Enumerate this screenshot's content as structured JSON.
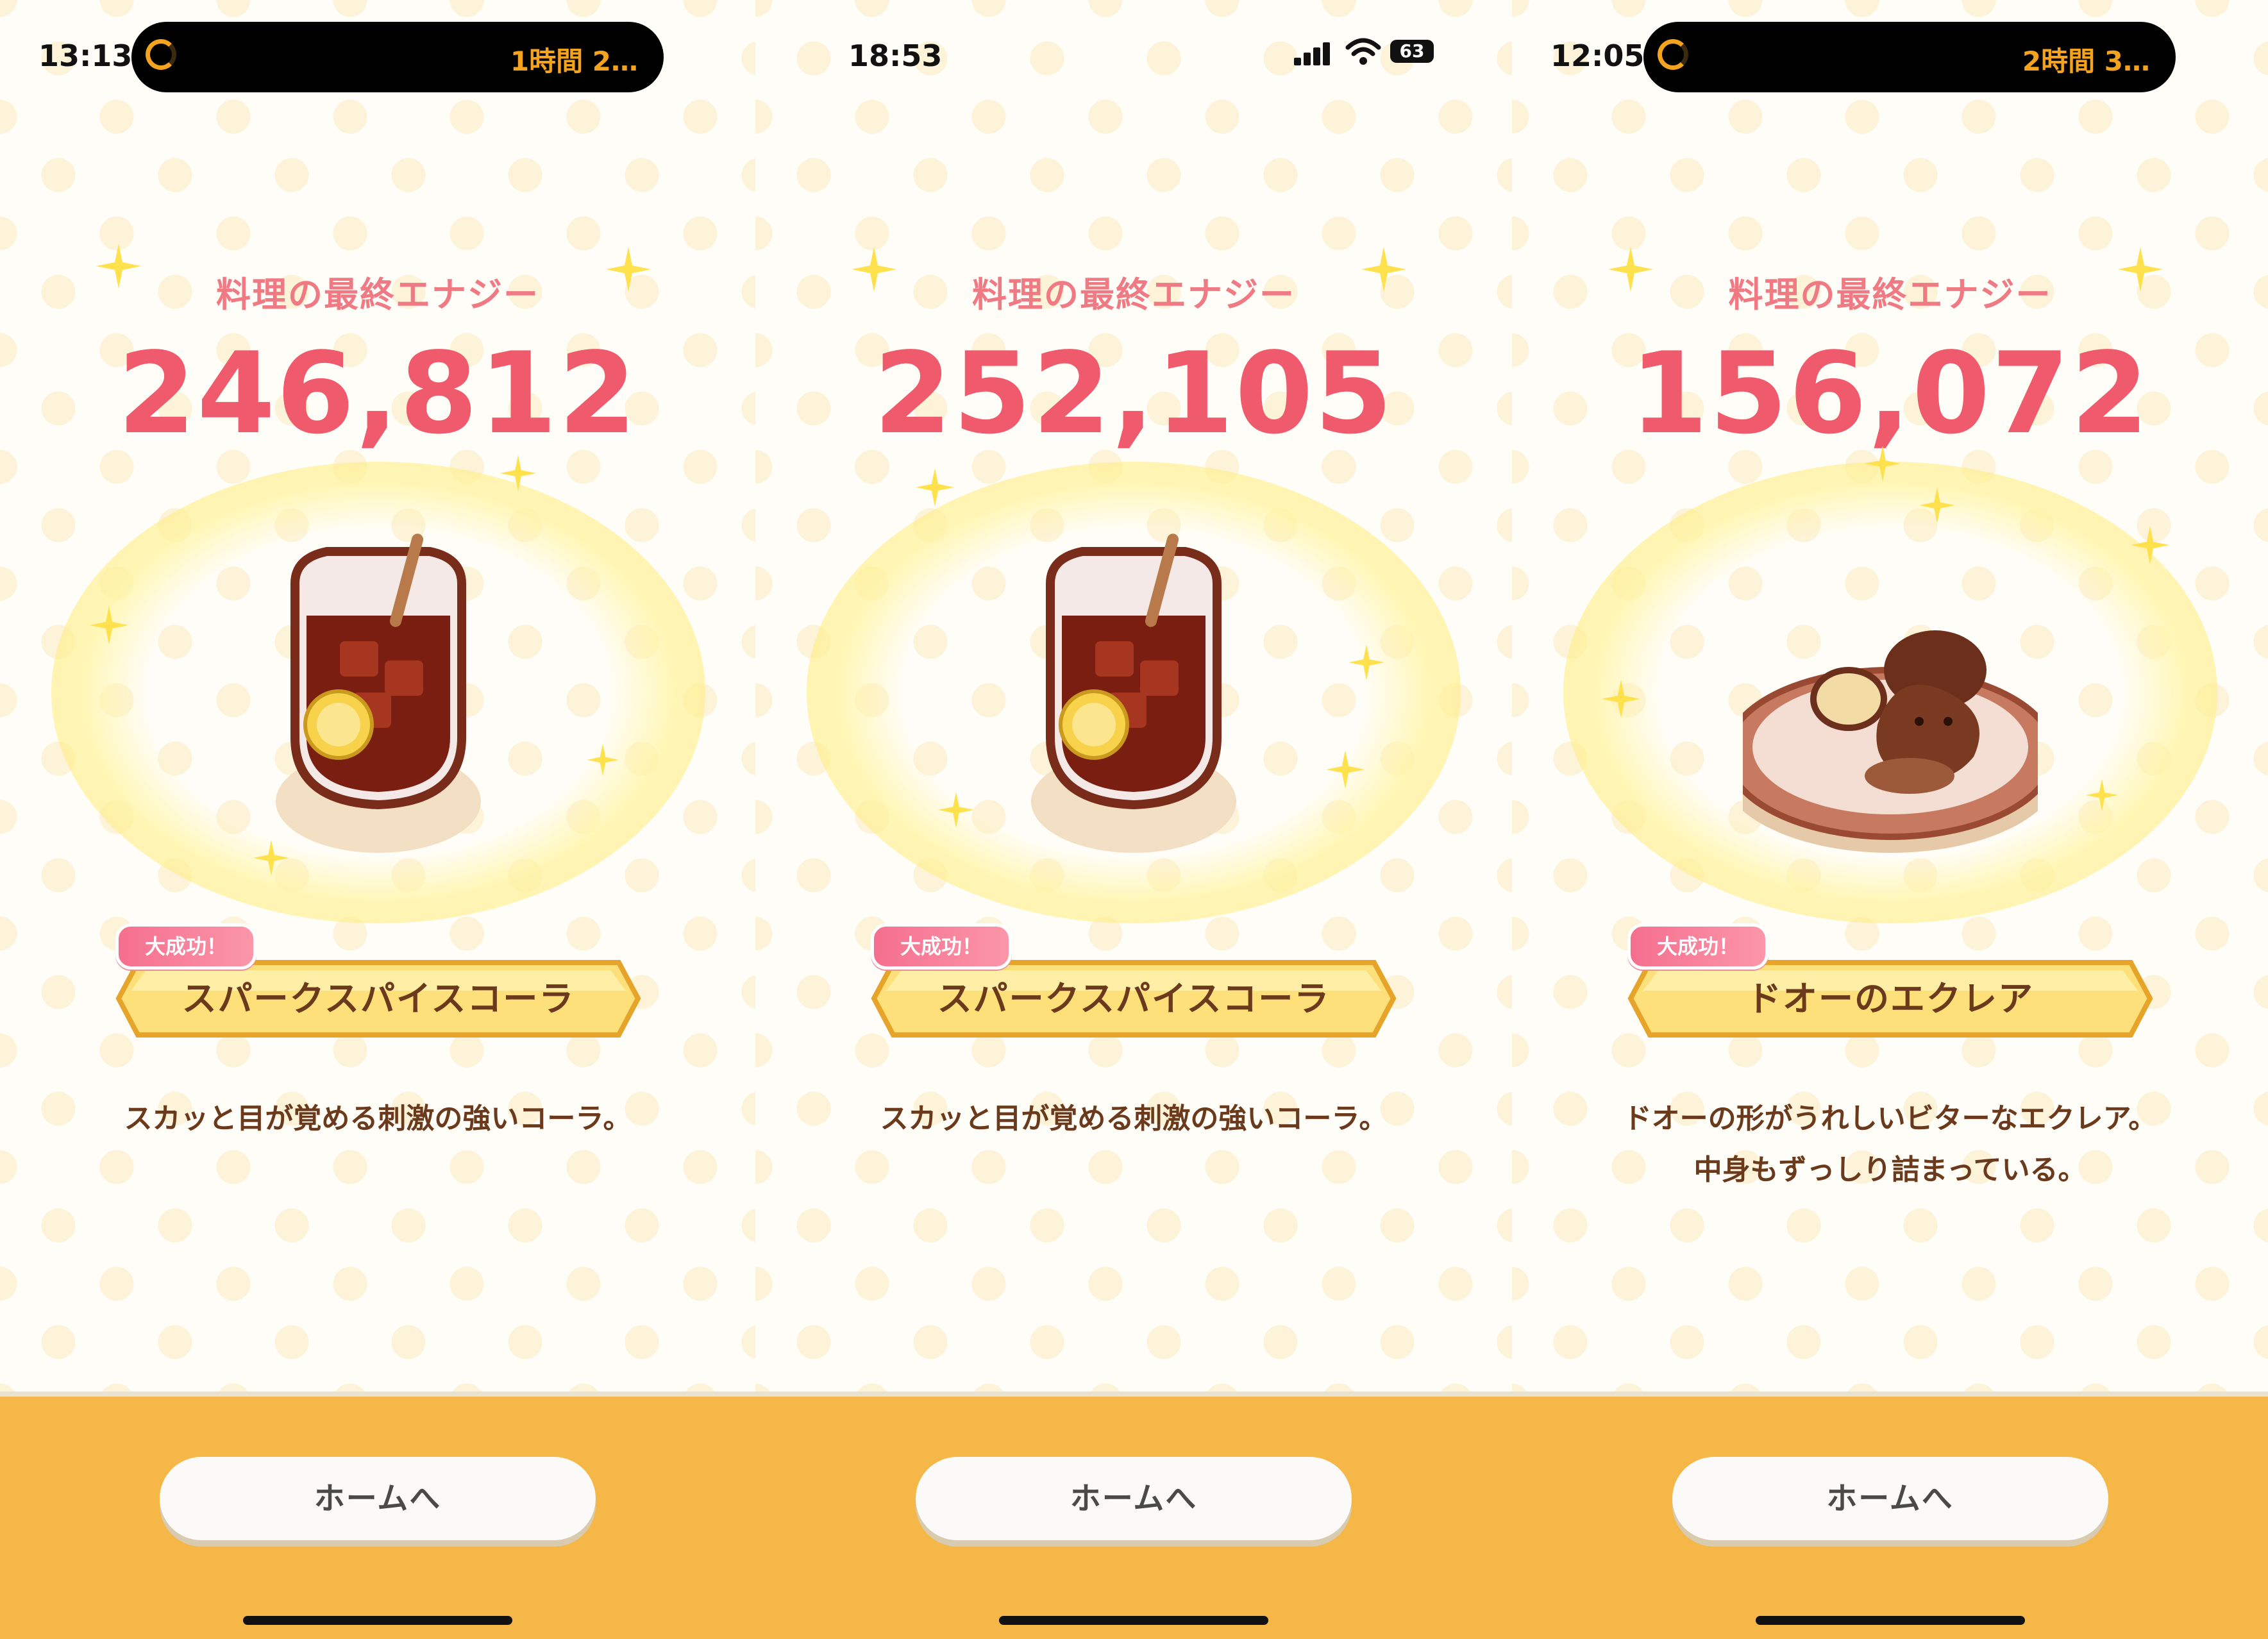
{
  "panels": [
    {
      "status": {
        "time": "13:13",
        "island_text": "1時間 2…"
      },
      "energy_label": "料理の最終エナジー",
      "energy_value": "246,812",
      "food_icon": "cola-glass-icon",
      "badge": "大成功！",
      "dish_name": "スパークスパイスコーラ",
      "description": [
        "スカッと目が覚める刺激の強いコーラ。"
      ],
      "home_button": "ホームへ"
    },
    {
      "status": {
        "time": "18:53",
        "battery": "63"
      },
      "energy_label": "料理の最終エナジー",
      "energy_value": "252,105",
      "food_icon": "cola-glass-icon",
      "badge": "大成功！",
      "dish_name": "スパークスパイスコーラ",
      "description": [
        "スカッと目が覚める刺激の強いコーラ。"
      ],
      "home_button": "ホームへ"
    },
    {
      "status": {
        "time": "12:05",
        "island_text": "2時間 3…"
      },
      "energy_label": "料理の最終エナジー",
      "energy_value": "156,072",
      "food_icon": "eclair-plate-icon",
      "badge": "大成功！",
      "dish_name": "ドオーのエクレア",
      "description": [
        "ドオーの形がうれしいビターなエクレア。",
        "中身もずっしり詰まっている。"
      ],
      "home_button": "ホームへ"
    }
  ],
  "colors": {
    "energy": "#ef5a6c",
    "label": "#f07a83",
    "ribbon": "#fde07a",
    "footer": "#f5b747",
    "text_brown": "#6b3a1c"
  }
}
